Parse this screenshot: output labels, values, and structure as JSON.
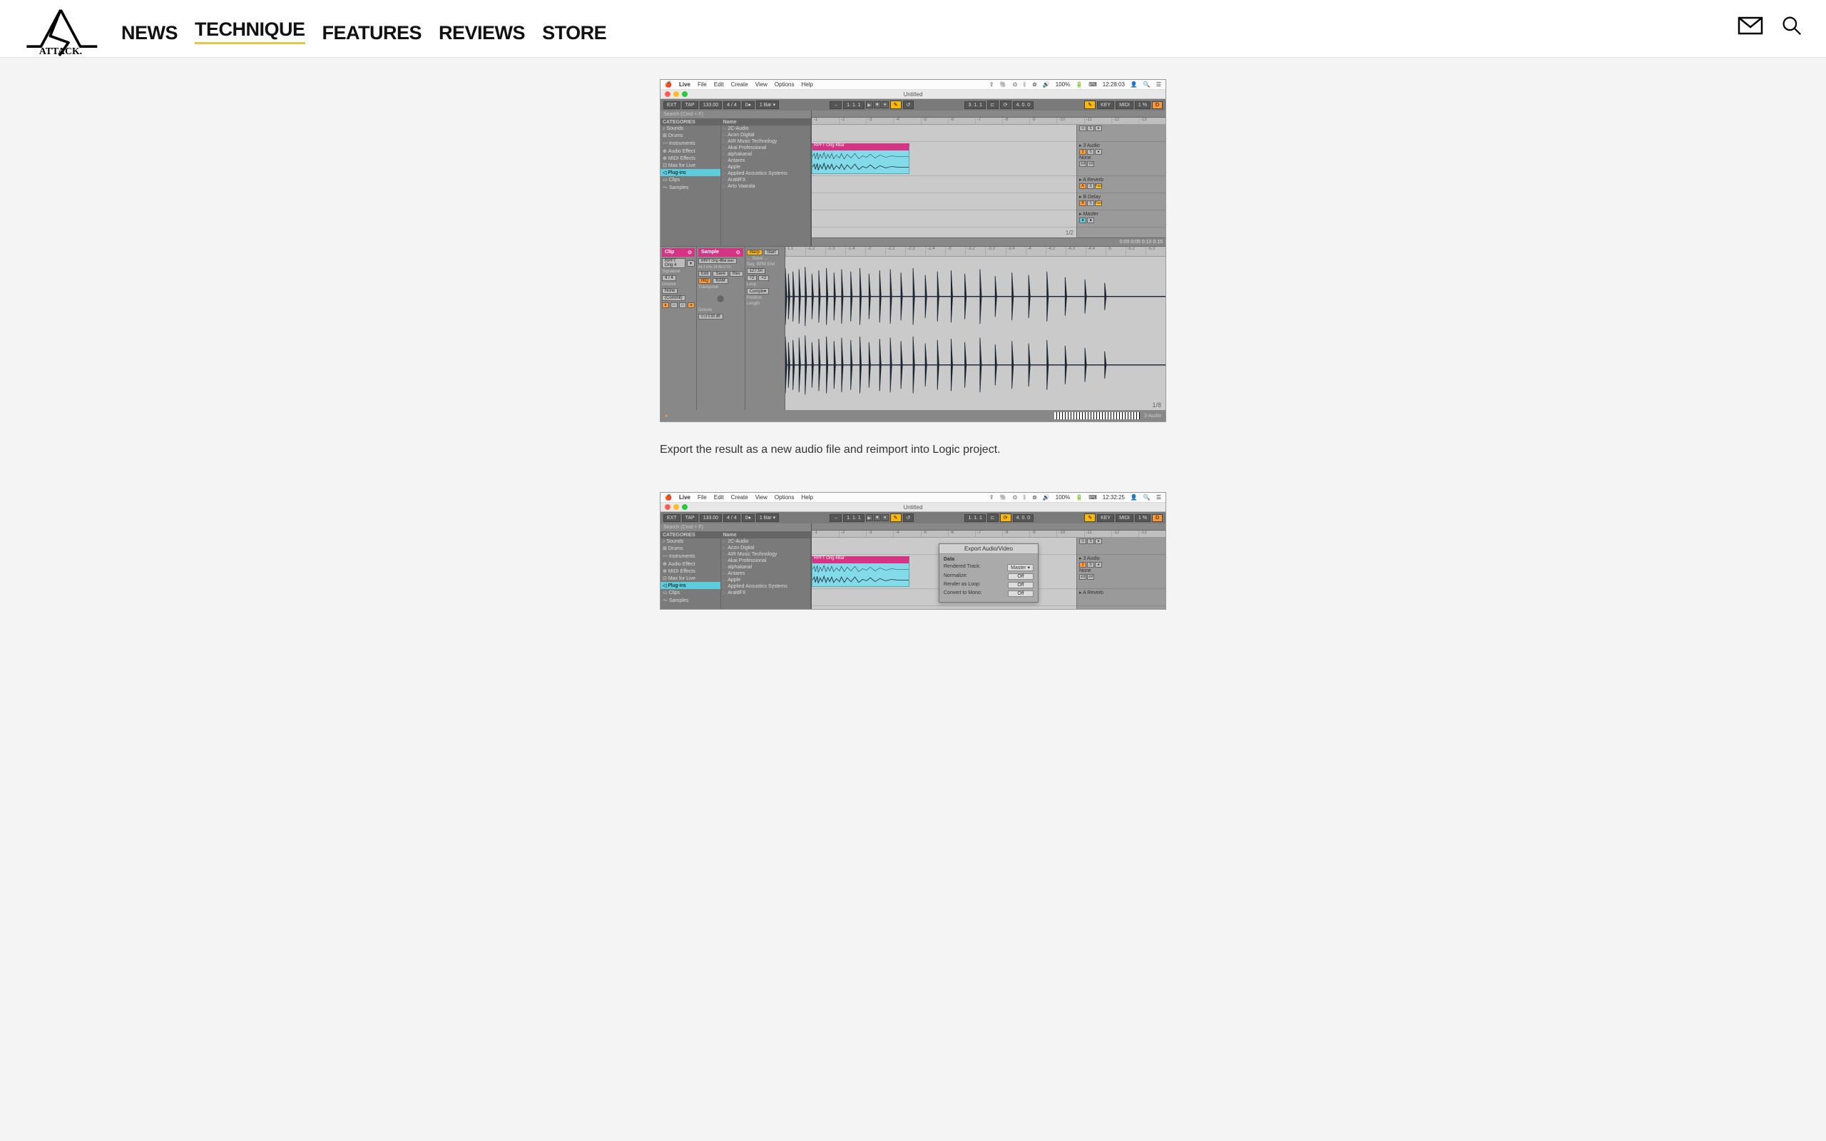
{
  "header": {
    "logo_text": "ATTACK.",
    "nav": [
      "NEWS",
      "TECHNIQUE",
      "FEATURES",
      "REVIEWS",
      "STORE"
    ],
    "active_nav": "TECHNIQUE"
  },
  "article": {
    "caption": "Export the result as a new audio file and reimport into Logic project."
  },
  "shot1": {
    "menubar": {
      "app": "Live",
      "menus": [
        "File",
        "Edit",
        "Create",
        "View",
        "Options",
        "Help"
      ],
      "battery": "100%",
      "time": "12:28:03"
    },
    "window_title": "Untitled",
    "toolbar": {
      "ext": "EXT",
      "tap": "TAP",
      "tempo": "133.00",
      "sig": "4 / 4",
      "metro": "0●",
      "bar": "1 Bar ▾",
      "pos": "1.  1.  1",
      "loop_pos": "3.  1.  1",
      "loop_len": "4.  0.  0",
      "key": "KEY",
      "midi": "MIDI",
      "cpu": "1 %",
      "d": "D"
    },
    "browser": {
      "search": "Search (Cmd + F)",
      "categories_header": "CATEGORIES",
      "categories": [
        "Sounds",
        "Drums",
        "Instruments",
        "Audio Effect",
        "MIDI Effects",
        "Max for Live",
        "Plug-ins",
        "Clips",
        "Samples"
      ],
      "selected_category": "Plug-ins",
      "name_header": "Name",
      "items": [
        "2C-Audio",
        "Acon Digital",
        "AIR Music Technology",
        "Akai Professional",
        "alphakanal",
        "Antares",
        "Apple",
        "Applied Acoustics Systems",
        "AraldFX",
        "Arto Vaarala"
      ]
    },
    "tracks": {
      "ruler_marks": [
        "-1",
        "-2",
        "-3",
        "-4",
        "-5",
        "-6",
        "-7",
        "-8",
        "-9",
        "-10",
        "-11",
        "-12",
        "-13"
      ],
      "clip_name": "RPFT Orig 4Bar",
      "loop_indicator": "0:00          0:05          0:10          0:15",
      "page": "1/2",
      "headers": [
        {
          "name": "3 Audio",
          "type": "audio"
        },
        {
          "name": "None",
          "type": "none"
        },
        {
          "name": "A Reverb",
          "type": "return"
        },
        {
          "name": "B Delay",
          "type": "return"
        },
        {
          "name": "Master",
          "type": "master"
        }
      ]
    },
    "clip_detail": {
      "clip_label": "Clip",
      "sample_label": "Sample",
      "clip_name": "RPFT Orig 4",
      "sample_name": "RPFT Orig 4Bar.wav",
      "sample_info": "44.1 kHz 24 Bit 2 Ch",
      "signature": "Signature",
      "sig_val": "4   /   4",
      "groove": "Groove",
      "groove_val": "None",
      "warp": "Warp",
      "start": "Start",
      "edit": "Edit",
      "save": "Save",
      "rev": "Rev",
      "hq": "HiQ",
      "ram": "RAM",
      "transpose": "Transpose",
      "detune": "Detune",
      "detune_val": "0 ct   0.00 dB",
      "seg_bpm": "Seg. BPM",
      "bpm_val": "127.50",
      "end": "End",
      "loop": "Loop",
      "position": "Position",
      "length": "Length",
      "complex": "Complx▾",
      "commit": "(Commit)",
      "wave_ruler": [
        "1.1",
        "-1.2",
        "-1.3",
        "-1.4",
        "-2",
        "-2.2",
        "-2.3",
        "-2.4",
        "-3",
        "-3.2",
        "-3.3",
        "-3.4",
        "-4",
        "-4.2",
        "-4.3",
        "-4.4",
        "-5",
        "-5.2",
        "-5.3"
      ],
      "zoom": "1/8"
    },
    "bottom_track": "3-Audio"
  },
  "shot2": {
    "menubar": {
      "time": "12:32:25"
    },
    "toolbar": {
      "pos": "1.  1.  1",
      "loop_pos": "1.  1.  1"
    },
    "export_dialog": {
      "title": "Export Audio/Video",
      "section": "Data",
      "rows": [
        {
          "label": "Rendered Track:",
          "value": "Master      ▾"
        },
        {
          "label": "Normalize:",
          "value": "Off"
        },
        {
          "label": "Render as Loop:",
          "value": "Off"
        },
        {
          "label": "Convert to Mono:",
          "value": "Off"
        }
      ]
    },
    "tracks": {
      "headers": [
        {
          "name": "3 Audio",
          "type": "audio"
        },
        {
          "name": "None",
          "type": "none"
        },
        {
          "name": "A Reverb",
          "type": "return"
        }
      ]
    }
  }
}
